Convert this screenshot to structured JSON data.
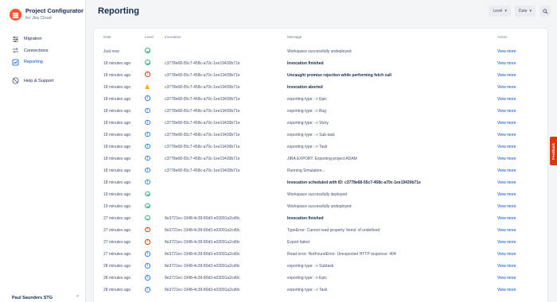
{
  "app": {
    "title": "Project Configurator",
    "subtitle": "for Jira Cloud",
    "brand_color": "#FF5630",
    "accent_color": "#0052CC"
  },
  "sidebar": {
    "items": [
      {
        "label": "Migration",
        "icon": "sliders-icon",
        "active": false
      },
      {
        "label": "Connections",
        "icon": "connections-icon",
        "active": false
      },
      {
        "label": "Reporting",
        "icon": "reporting-icon",
        "active": true
      },
      {
        "label": "Help & Support",
        "icon": "help-icon",
        "active": false
      }
    ],
    "user": "Paul Saunders STG"
  },
  "header": {
    "title": "Reporting",
    "level_filter": "Level",
    "date_filter": "Date"
  },
  "table": {
    "columns": [
      "Date",
      "Level",
      "Invocation",
      "Message",
      "Action"
    ],
    "action_label": "View more",
    "rows": [
      {
        "date": "Just now",
        "level": "success",
        "invocation": "",
        "message": "Workspace successfully undeployed",
        "bold": false
      },
      {
        "date": "18 minutes ago",
        "level": "success",
        "invocation": "c3778e68-55c7-458c-a70c-1ee19430b71e",
        "message": "Invocation finished",
        "bold": true
      },
      {
        "date": "18 minutes ago",
        "level": "error",
        "invocation": "c3778e68-55c7-458c-a70c-1ee19430b71e",
        "message": "Uncaught promise rejection while performing fetch call",
        "bold": true
      },
      {
        "date": "18 minutes ago",
        "level": "warning",
        "invocation": "c3778e68-55c7-458c-a70c-1ee19430b71e",
        "message": "Invocation aborted",
        "bold": true
      },
      {
        "date": "18 minutes ago",
        "level": "info",
        "invocation": "c3778e68-55c7-458c-a70c-1ee19430b71e",
        "message": "exporting type: -> Epic",
        "bold": false
      },
      {
        "date": "18 minutes ago",
        "level": "info",
        "invocation": "c3778e68-55c7-458c-a70c-1ee19430b71e",
        "message": "exporting type: -> Bug",
        "bold": false
      },
      {
        "date": "18 minutes ago",
        "level": "info",
        "invocation": "c3778e68-55c7-458c-a70c-1ee19430b71e",
        "message": "exporting type: -> Story",
        "bold": false
      },
      {
        "date": "18 minutes ago",
        "level": "info",
        "invocation": "c3778e68-55c7-458c-a70c-1ee19430b71e",
        "message": "exporting type: -> Sub-task",
        "bold": false
      },
      {
        "date": "18 minutes ago",
        "level": "info",
        "invocation": "c3778e68-55c7-458c-a70c-1ee19430b71e",
        "message": "exporting type: -> Task",
        "bold": false
      },
      {
        "date": "18 minutes ago",
        "level": "info",
        "invocation": "c3778e68-55c7-458c-a70c-1ee19430b71e",
        "message": "JIRA EXPORT: Exporting project ADAM",
        "bold": false
      },
      {
        "date": "18 minutes ago",
        "level": "info",
        "invocation": "c3778e68-55c7-458c-a70c-1ee19430b71e",
        "message": "Running Simulation...",
        "bold": false
      },
      {
        "date": "18 minutes ago",
        "level": "info",
        "invocation": "",
        "message": "Invocation scheduled with ID: c3778e68-55c7-458c-a70c-1ee19430b71e",
        "bold": true
      },
      {
        "date": "19 minutes ago",
        "level": "success",
        "invocation": "",
        "message": "Workspace successfully deployed",
        "bold": false
      },
      {
        "date": "19 minutes ago",
        "level": "success",
        "invocation": "",
        "message": "Workspace successfully undeployed",
        "bold": false
      },
      {
        "date": "27 minutes ago",
        "level": "success",
        "invocation": "8e3721ec-1948-4c39-80d3-e03091a2cd9c",
        "message": "Invocation finished",
        "bold": true
      },
      {
        "date": "27 minutes ago",
        "level": "error",
        "invocation": "8e3721ec-1948-4c39-80d3-e03091a2cd9c",
        "message": "TypeError: Cannot read property 'items' of undefined",
        "bold": false
      },
      {
        "date": "27 minutes ago",
        "level": "error",
        "invocation": "8e3721ec-1948-4c39-80d3-e03091a2cd9c",
        "message": "Export failed",
        "bold": false
      },
      {
        "date": "27 minutes ago",
        "level": "info",
        "invocation": "8e3721ec-1948-4c39-80d3-e03091a2cd9c",
        "message": "Read error: NotFoundError: Unexpected HTTP response: 404",
        "bold": false
      },
      {
        "date": "28 minutes ago",
        "level": "info",
        "invocation": "8e3721ec-1948-4c39-80d3-e03091a2cd9c",
        "message": "exporting type: -> Subtask",
        "bold": false
      },
      {
        "date": "28 minutes ago",
        "level": "info",
        "invocation": "8e3721ec-1948-4c39-80d3-e03091a2cd9c",
        "message": "exporting type: -> Epic",
        "bold": false
      },
      {
        "date": "28 minutes ago",
        "level": "info",
        "invocation": "8e3721ec-1948-4c39-80d3-e03091a2cd9c",
        "message": "exporting type: -> Task",
        "bold": false
      }
    ]
  },
  "feedback": {
    "label": "Feedback"
  }
}
